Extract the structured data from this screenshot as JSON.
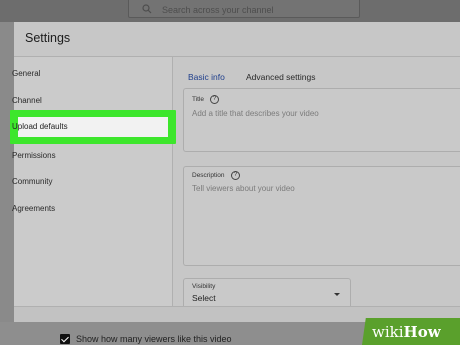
{
  "background": {
    "search_placeholder": "Search across your channel",
    "bottom_checkbox_label": "Show how many viewers like this video",
    "bottom_checkbox_checked": true
  },
  "dialog": {
    "title": "Settings",
    "sidebar": {
      "items": [
        {
          "label": "General"
        },
        {
          "label": "Channel"
        },
        {
          "label": "Upload defaults",
          "selected": true
        },
        {
          "label": "Permissions"
        },
        {
          "label": "Community"
        },
        {
          "label": "Agreements"
        }
      ]
    },
    "tabs": [
      {
        "label": "Basic info",
        "active": true
      },
      {
        "label": "Advanced settings",
        "active": false
      }
    ],
    "title_field": {
      "label": "Title",
      "placeholder": "Add a title that describes your video"
    },
    "description_field": {
      "label": "Description",
      "placeholder": "Tell viewers about your video"
    },
    "visibility_field": {
      "label": "Visibility",
      "value": "Select"
    }
  },
  "colors": {
    "highlight": "#3de62c",
    "accent_tab": "#1f3f8c",
    "watermark_green": "#5aa02c"
  },
  "watermark": {
    "prefix": "wiki",
    "suffix": "How"
  }
}
